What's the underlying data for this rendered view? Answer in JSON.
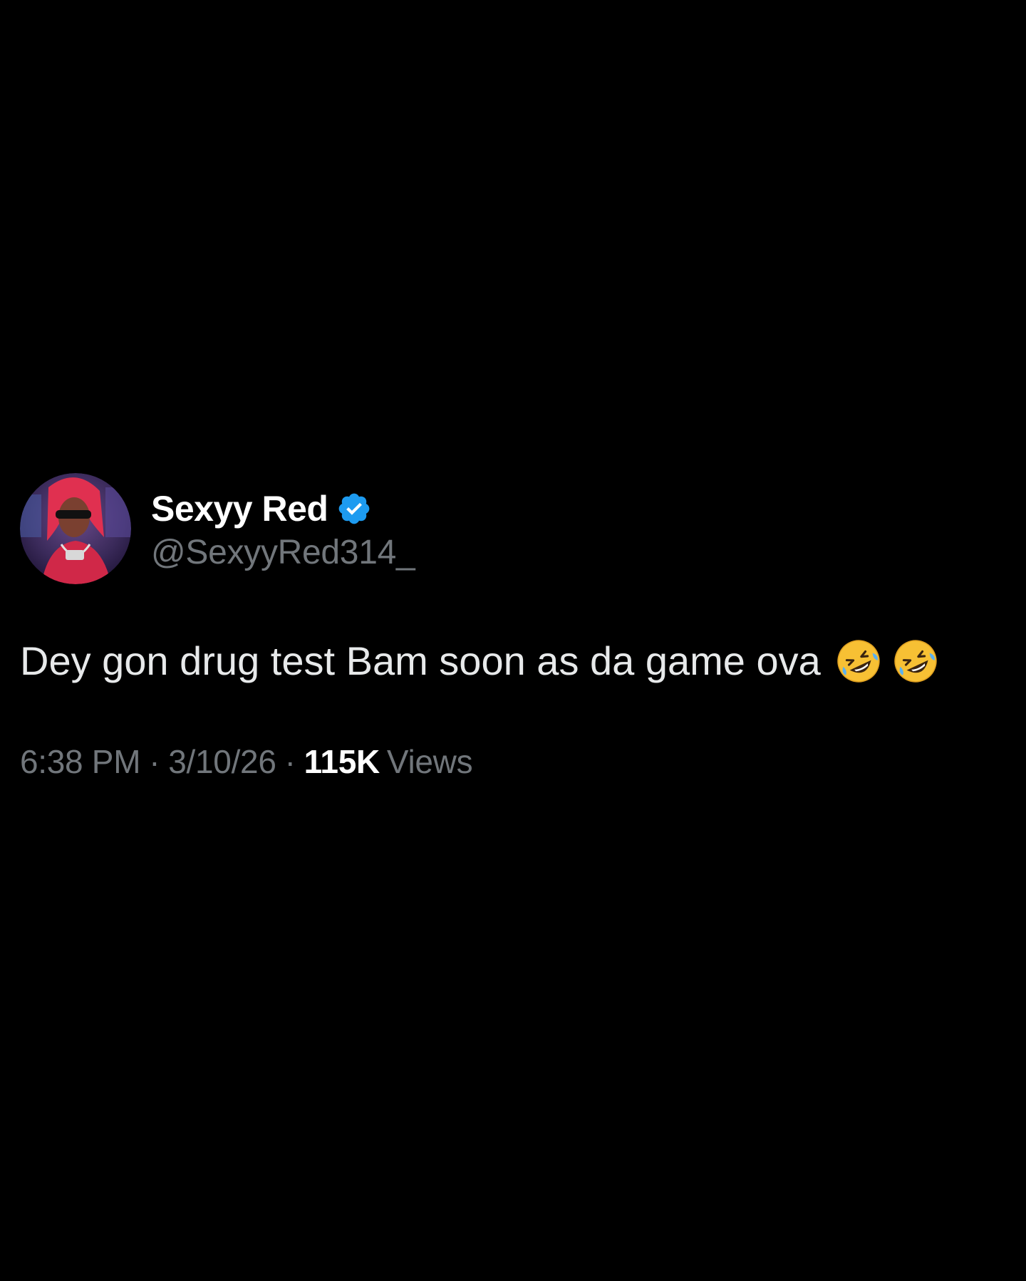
{
  "author": {
    "display_name": "Sexyy Red",
    "handle": "@SexyyRed314_",
    "verified": true,
    "verified_color": "#1d9bf0"
  },
  "tweet": {
    "text": "Dey gon drug test Bam soon as da game ova",
    "emojis": [
      "rolling-on-the-floor-laughing-icon",
      "rolling-on-the-floor-laughing-icon"
    ]
  },
  "meta": {
    "time": "6:38 PM",
    "separator": "·",
    "date": "3/10/26",
    "views_count": "115K",
    "views_label": "Views"
  },
  "colors": {
    "background": "#000000",
    "primary_text": "#e7e9ea",
    "secondary_text": "#71767b",
    "accent": "#1d9bf0"
  }
}
